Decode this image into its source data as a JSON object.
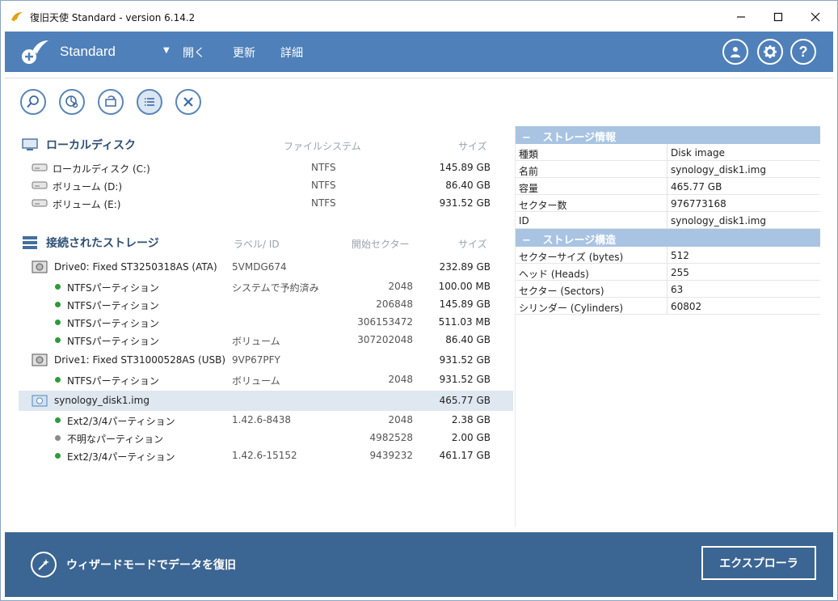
{
  "window": {
    "title": "復旧天使 Standard - version 6.14.2",
    "controls": [
      "minimize",
      "maximize",
      "close"
    ]
  },
  "appbar": {
    "brand": "Standard",
    "menu": [
      "開く",
      "更新",
      "詳細"
    ],
    "icons": [
      "user-icon",
      "gear-icon",
      "help-icon"
    ]
  },
  "toolbar": {
    "icons": [
      "search-icon",
      "partition-scan-icon",
      "restore-icon",
      "list-icon",
      "close-icon"
    ]
  },
  "local_disks": {
    "heading": "ローカルディスク",
    "col_fs": "ファイルシステム",
    "col_size": "サイズ",
    "items": [
      {
        "name": "ローカルディスク (C:)",
        "fs": "NTFS",
        "size": "145.89 GB"
      },
      {
        "name": "ボリューム (D:)",
        "fs": "NTFS",
        "size": "86.40 GB"
      },
      {
        "name": "ボリューム (E:)",
        "fs": "NTFS",
        "size": "931.52 GB"
      }
    ]
  },
  "connected": {
    "heading": "接続されたストレージ",
    "col_label": "ラベル/ ID",
    "col_start": "開始セクター",
    "col_size": "サイズ",
    "rows": [
      {
        "type": "drive",
        "name": "Drive0: Fixed ST3250318AS (ATA)",
        "label": "5VMDG674",
        "start": "",
        "size": "232.89 GB"
      },
      {
        "type": "part",
        "name": "NTFSパーティション",
        "label": "システムで予約済み",
        "start": "2048",
        "size": "100.00 MB"
      },
      {
        "type": "part",
        "name": "NTFSパーティション",
        "label": "",
        "start": "206848",
        "size": "145.89 GB"
      },
      {
        "type": "part",
        "name": "NTFSパーティション",
        "label": "",
        "start": "306153472",
        "size": "511.03 MB"
      },
      {
        "type": "part",
        "name": "NTFSパーティション",
        "label": "ボリューム",
        "start": "307202048",
        "size": "86.40 GB"
      },
      {
        "type": "drive",
        "name": "Drive1: Fixed ST31000528AS (USB)",
        "label": "9VP67PFY",
        "start": "",
        "size": "931.52 GB"
      },
      {
        "type": "part",
        "name": "NTFSパーティション",
        "label": "ボリューム",
        "start": "2048",
        "size": "931.52 GB"
      },
      {
        "type": "image",
        "name": "synology_disk1.img",
        "label": "",
        "start": "",
        "size": "465.77 GB"
      },
      {
        "type": "part",
        "name": "Ext2/3/4パーティション",
        "label": "1.42.6-8438",
        "start": "2048",
        "size": "2.38 GB"
      },
      {
        "type": "part-unknown",
        "name": "不明なパーティション",
        "label": "",
        "start": "4982528",
        "size": "2.00 GB"
      },
      {
        "type": "part",
        "name": "Ext2/3/4パーティション",
        "label": "1.42.6-15152",
        "start": "9439232",
        "size": "461.17 GB"
      }
    ]
  },
  "storage_info": {
    "heading": "ストレージ情報",
    "rows": [
      {
        "k": "種類",
        "v": "Disk image"
      },
      {
        "k": "名前",
        "v": "synology_disk1.img"
      },
      {
        "k": "容量",
        "v": "465.77 GB"
      },
      {
        "k": "セクター数",
        "v": "976773168"
      },
      {
        "k": "ID",
        "v": "synology_disk1.img"
      }
    ]
  },
  "storage_struct": {
    "heading": "ストレージ構造",
    "rows": [
      {
        "k": "セクターサイズ (bytes)",
        "v": "512"
      },
      {
        "k": "ヘッド (Heads)",
        "v": "255"
      },
      {
        "k": "セクター (Sectors)",
        "v": "63"
      },
      {
        "k": "シリンダー (Cylinders)",
        "v": "60802"
      }
    ]
  },
  "footer": {
    "wizard_label": "ウィザードモードでデータを復旧",
    "explorer_label": "エクスプローラ"
  },
  "colors": {
    "appbar": "#4f80b9",
    "footer": "#3b6592",
    "panel_head": "#a8c4e2",
    "partition_ok": "#2e9a3a",
    "partition_unknown": "#8a8a8a"
  }
}
